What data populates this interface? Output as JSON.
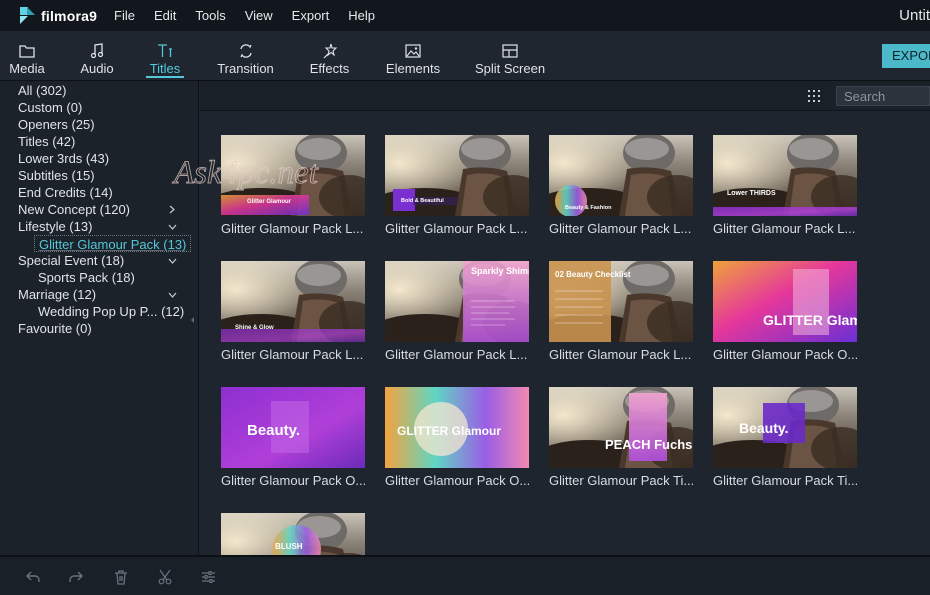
{
  "app": {
    "name": "filmora9",
    "window_title": "Untit"
  },
  "menu": [
    "File",
    "Edit",
    "Tools",
    "View",
    "Export",
    "Help"
  ],
  "tabs": [
    {
      "label": "Media",
      "icon": "folder-icon"
    },
    {
      "label": "Audio",
      "icon": "music-note-icon"
    },
    {
      "label": "Titles",
      "icon": "text-title-icon",
      "active": true
    },
    {
      "label": "Transition",
      "icon": "transition-icon"
    },
    {
      "label": "Effects",
      "icon": "effects-icon"
    },
    {
      "label": "Elements",
      "icon": "image-icon"
    },
    {
      "label": "Split Screen",
      "icon": "split-screen-icon"
    }
  ],
  "export_label": "EXPOR",
  "categories": [
    {
      "label": "All (302)"
    },
    {
      "label": "Custom (0)"
    },
    {
      "label": "Openers (25)"
    },
    {
      "label": "Titles (42)"
    },
    {
      "label": "Lower 3rds (43)"
    },
    {
      "label": "Subtitles (15)"
    },
    {
      "label": "End Credits (14)"
    },
    {
      "label": "New Concept (120)",
      "chevron": "right"
    },
    {
      "label": "Lifestyle (13)",
      "chevron": "down"
    },
    {
      "label": "Glitter Glamour Pack (13)",
      "sub": true,
      "selected": true
    },
    {
      "label": "Special Event (18)",
      "chevron": "down"
    },
    {
      "label": "Sports Pack (18)",
      "sub": true
    },
    {
      "label": "Marriage (12)",
      "chevron": "down"
    },
    {
      "label": "Wedding Pop Up P... (12)",
      "sub": true
    },
    {
      "label": "Favourite (0)"
    }
  ],
  "search": {
    "placeholder": "Search"
  },
  "watermark": "Ask4pc.net",
  "items": [
    {
      "label": "Glitter Glamour Pack L...",
      "thumb_text": "Glitter Glamour",
      "style": "photo-banner"
    },
    {
      "label": "Glitter Glamour Pack L...",
      "thumb_text": "Bold & Beautiful",
      "style": "photo-box"
    },
    {
      "label": "Glitter Glamour Pack L...",
      "thumb_text": "Beauty & Fashion",
      "style": "photo-circle"
    },
    {
      "label": "Glitter Glamour Pack L...",
      "thumb_text": "Lower THIRDS",
      "style": "photo-lower"
    },
    {
      "label": "Glitter Glamour Pack L...",
      "thumb_text": "Shine & Glow",
      "style": "photo-glow"
    },
    {
      "label": "Glitter Glamour Pack L...",
      "thumb_text": "Sparkly Shimmer",
      "style": "photo-panel"
    },
    {
      "label": "Glitter Glamour Pack L...",
      "thumb_text": "02 Beauty Checklist",
      "style": "photo-checklist"
    },
    {
      "label": "Glitter Glamour Pack O...",
      "thumb_text": "GLITTER Glamour",
      "style": "gradient-glamour"
    },
    {
      "label": "Glitter Glamour Pack O...",
      "thumb_text": "Beauty.",
      "style": "purple-beauty"
    },
    {
      "label": "Glitter Glamour Pack O...",
      "thumb_text": "GLITTER Glamour",
      "style": "rainbow-circle"
    },
    {
      "label": "Glitter Glamour Pack Ti...",
      "thumb_text": "PEACH Fuchsia",
      "style": "photo-fuchsia"
    },
    {
      "label": "Glitter Glamour Pack Ti...",
      "thumb_text": "Beauty.",
      "style": "photo-beauty"
    },
    {
      "label": "",
      "thumb_text": "BLUSH",
      "style": "photo-blush"
    }
  ],
  "bottom_tools": [
    {
      "name": "undo-icon"
    },
    {
      "name": "redo-icon"
    },
    {
      "name": "delete-icon"
    },
    {
      "name": "cut-icon"
    },
    {
      "name": "adjust-icon"
    }
  ],
  "colors": {
    "accent": "#54c8d9",
    "background": "#1e252e",
    "menubar": "#12171d"
  }
}
